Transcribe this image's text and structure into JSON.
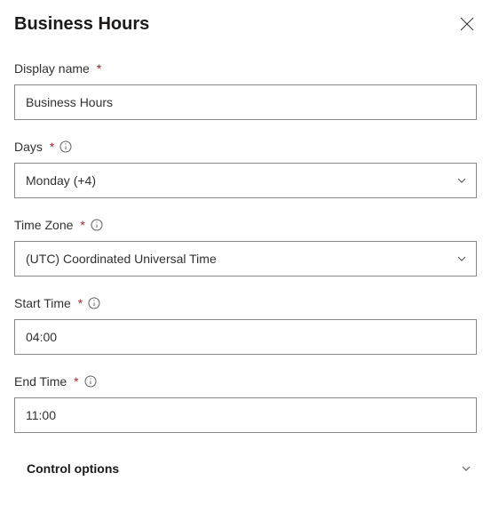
{
  "header": {
    "title": "Business Hours"
  },
  "fields": {
    "displayName": {
      "label": "Display name",
      "value": "Business Hours"
    },
    "days": {
      "label": "Days",
      "value": "Monday (+4)"
    },
    "timeZone": {
      "label": "Time Zone",
      "value": "(UTC) Coordinated Universal Time"
    },
    "startTime": {
      "label": "Start Time",
      "value": "04:00"
    },
    "endTime": {
      "label": "End Time",
      "value": "11:00"
    }
  },
  "accordion": {
    "controlOptions": "Control options"
  },
  "required": "*"
}
